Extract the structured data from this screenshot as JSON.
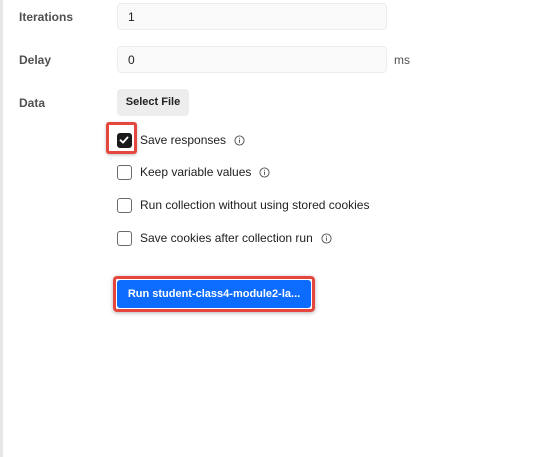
{
  "form": {
    "iterations": {
      "label": "Iterations",
      "value": "1"
    },
    "delay": {
      "label": "Delay",
      "value": "0",
      "unit": "ms"
    },
    "data": {
      "label": "Data",
      "button_label": "Select File"
    }
  },
  "options": [
    {
      "label": "Save responses",
      "checked": true,
      "has_info": true
    },
    {
      "label": "Keep variable values",
      "checked": false,
      "has_info": true
    },
    {
      "label": "Run collection without using stored cookies",
      "checked": false,
      "has_info": false
    },
    {
      "label": "Save cookies after collection run",
      "checked": false,
      "has_info": true
    }
  ],
  "run_button": {
    "label": "Run student-class4-module2-la..."
  },
  "colors": {
    "accent": "#0b6cff",
    "highlight": "#e5473f",
    "checkbox_checked": "#1a1a1a"
  },
  "icons": {
    "info": "info-icon",
    "check": "check-icon"
  }
}
